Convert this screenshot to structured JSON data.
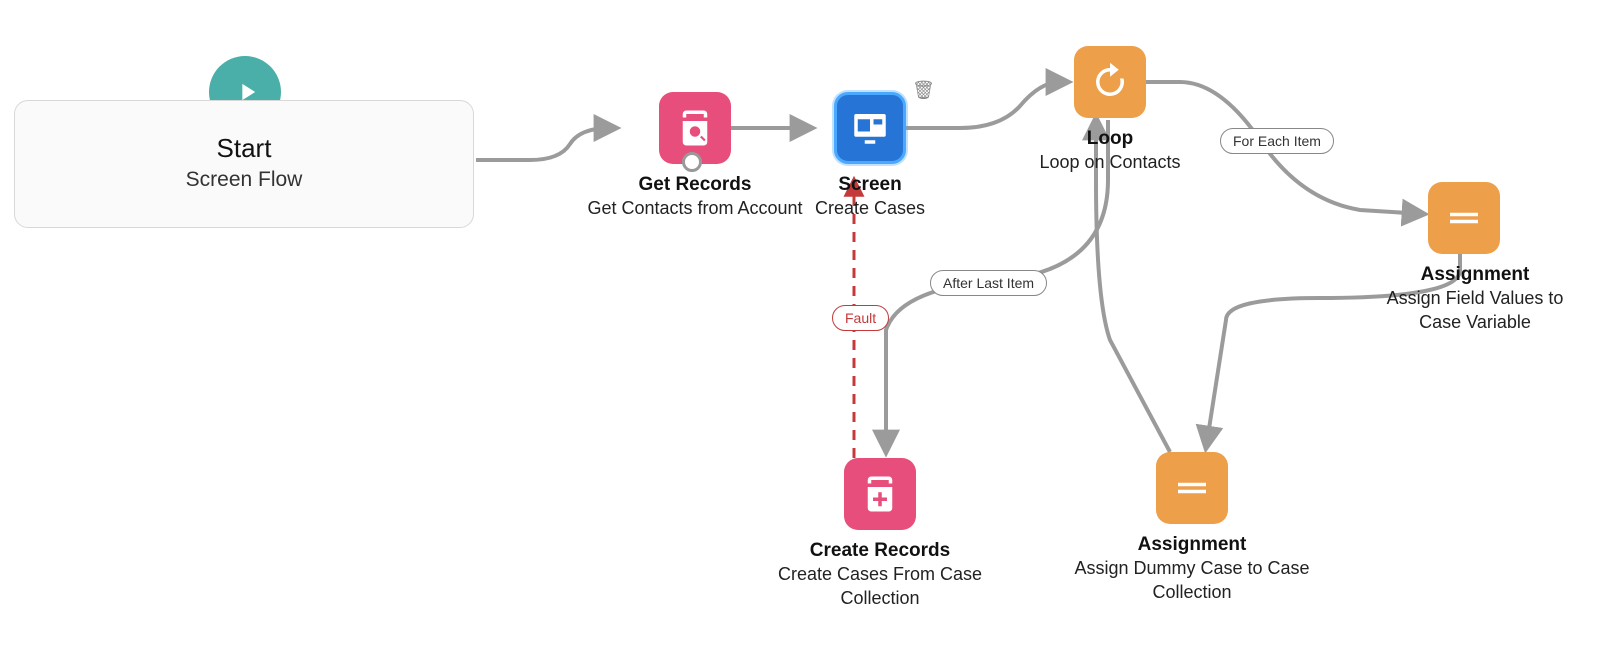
{
  "nodes": {
    "start": {
      "title": "Start",
      "subtitle": "Screen Flow"
    },
    "getRecords": {
      "title": "Get Records",
      "subtitle": "Get Contacts from Account"
    },
    "screen": {
      "title": "Screen",
      "subtitle": "Create Cases"
    },
    "loop": {
      "title": "Loop",
      "subtitle": "Loop on Contacts"
    },
    "assignment1": {
      "title": "Assignment",
      "subtitle": "Assign Field Values to Case Variable"
    },
    "assignment2": {
      "title": "Assignment",
      "subtitle": "Assign Dummy Case to Case Collection"
    },
    "createRecords": {
      "title": "Create Records",
      "subtitle": "Create Cases From Case Collection"
    }
  },
  "labels": {
    "forEach": "For Each Item",
    "afterLast": "After Last Item",
    "fault": "Fault"
  },
  "colors": {
    "pink": "#e74e7b",
    "orange": "#ee9f4a",
    "blue": "#2574d6",
    "teal": "#4aafa8",
    "connector": "#9b9b9b",
    "faultRed": "#c43a3a"
  }
}
